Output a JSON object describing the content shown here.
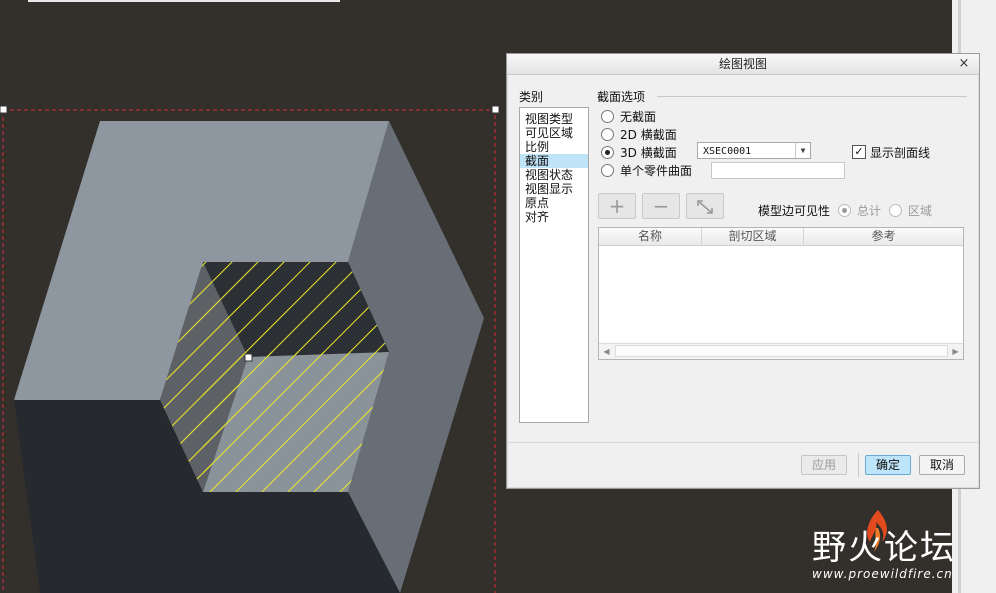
{
  "dialog": {
    "title": "绘图视图",
    "close_glyph": "×",
    "category_label": "类别",
    "categories": [
      "视图类型",
      "可见区域",
      "比例",
      "截面",
      "视图状态",
      "视图显示",
      "原点",
      "对齐"
    ],
    "selected_category": "截面",
    "section_options_label": "截面选项",
    "radio_options": [
      "无截面",
      "2D 横截面",
      "3D 横截面",
      "单个零件曲面"
    ],
    "selected_radio": "3D 横截面",
    "xsec_value": "XSEC0001",
    "show_hatch_label": "显示剖面线",
    "show_hatch_checked": true,
    "tools": {
      "add_glyph": "+",
      "remove_glyph": "−"
    },
    "edge_visibility_label": "模型边可见性",
    "edge_visibility_options": [
      "总计",
      "区域"
    ],
    "edge_visibility_selected": "总计",
    "table_headers": [
      "名称",
      "剖切区域",
      "参考"
    ],
    "buttons": {
      "apply": "应用",
      "ok": "确定",
      "cancel": "取消"
    }
  },
  "watermark": {
    "text": "野火论坛",
    "url": "www.proewildfire.cn"
  },
  "colors": {
    "background": "#33302c",
    "hatch": "#e8e82a",
    "selection_border": "#d42a3a",
    "ok_button": "#bde4f8"
  }
}
